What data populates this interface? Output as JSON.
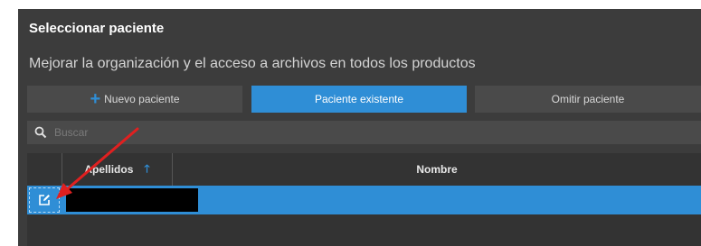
{
  "dialog": {
    "title": "Seleccionar paciente",
    "subtitle": "Mejorar la organización y el acceso a archivos en todos los productos"
  },
  "buttons": {
    "new_patient": "Nuevo paciente",
    "existing_patient": "Paciente existente",
    "skip_patient": "Omitir paciente"
  },
  "search": {
    "placeholder": "Buscar"
  },
  "table": {
    "columns": [
      "Apellidos",
      "Nombre"
    ],
    "sort": {
      "column": "Apellidos",
      "direction": "ascending"
    },
    "rows": [
      {
        "apellidos": "",
        "nombre": "",
        "selected": true,
        "redacted": true
      }
    ]
  },
  "colors": {
    "accent": "#2f8ed6",
    "panel_bg": "#3c3c3c",
    "annotation_arrow": "#e02020"
  },
  "icons": {
    "new_patient": "plus-icon",
    "search": "search-icon",
    "sort": "sort-up-arrow-icon",
    "row_action": "edit-icon"
  }
}
